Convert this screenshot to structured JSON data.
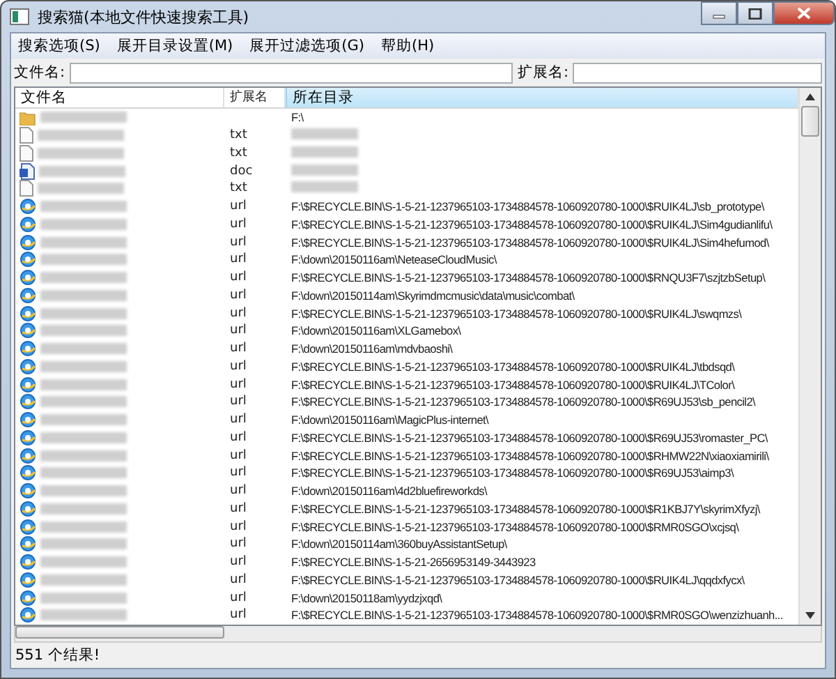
{
  "window": {
    "title": "搜索猫(本地文件快速搜索工具)"
  },
  "menu": [
    "搜索选项(S)",
    "展开目录设置(M)",
    "展开过滤选项(G)",
    "帮助(H)"
  ],
  "filters": [
    {
      "label": "文件名:"
    },
    {
      "label": "扩展名:"
    }
  ],
  "table": {
    "columns": [
      "文件名",
      "扩展名",
      "所在目录"
    ],
    "rows": [
      {
        "kind": "folder",
        "dir": "F:\\"
      },
      {
        "kind": "text",
        "ext": "txt"
      },
      {
        "kind": "text",
        "ext": "txt"
      },
      {
        "kind": "doc",
        "ext": "doc"
      },
      {
        "kind": "text",
        "ext": "txt"
      },
      {
        "kind": "web",
        "ext": "url",
        "dir": "F:\\$RECYCLE.BIN\\S-1-5-21-1237965103-1734884578-1060920780-1000\\$RUIK4LJ\\sb_prototype\\"
      },
      {
        "kind": "web",
        "ext": "url",
        "dir": "F:\\$RECYCLE.BIN\\S-1-5-21-1237965103-1734884578-1060920780-1000\\$RUIK4LJ\\Sim4gudianlifu\\"
      },
      {
        "kind": "web",
        "ext": "url",
        "dir": "F:\\$RECYCLE.BIN\\S-1-5-21-1237965103-1734884578-1060920780-1000\\$RUIK4LJ\\Sim4hefumod\\"
      },
      {
        "kind": "web",
        "ext": "url",
        "dir": "F:\\down\\20150116am\\NeteaseCloudMusic\\"
      },
      {
        "kind": "web",
        "ext": "url",
        "dir": "F:\\$RECYCLE.BIN\\S-1-5-21-1237965103-1734884578-1060920780-1000\\$RNQU3F7\\szjtzbSetup\\"
      },
      {
        "kind": "web",
        "ext": "url",
        "dir": "F:\\down\\20150114am\\Skyrimdmcmusic\\data\\music\\combat\\"
      },
      {
        "kind": "web",
        "ext": "url",
        "dir": "F:\\$RECYCLE.BIN\\S-1-5-21-1237965103-1734884578-1060920780-1000\\$RUIK4LJ\\swqmzs\\"
      },
      {
        "kind": "web",
        "ext": "url",
        "dir": "F:\\down\\20150116am\\XLGamebox\\"
      },
      {
        "kind": "web",
        "ext": "url",
        "dir": "F:\\down\\20150116am\\mdvbaoshi\\"
      },
      {
        "kind": "web",
        "ext": "url",
        "dir": "F:\\$RECYCLE.BIN\\S-1-5-21-1237965103-1734884578-1060920780-1000\\$RUIK4LJ\\tbdsqd\\"
      },
      {
        "kind": "web",
        "ext": "url",
        "dir": "F:\\$RECYCLE.BIN\\S-1-5-21-1237965103-1734884578-1060920780-1000\\$RUIK4LJ\\TColor\\"
      },
      {
        "kind": "web",
        "ext": "url",
        "dir": "F:\\$RECYCLE.BIN\\S-1-5-21-1237965103-1734884578-1060920780-1000\\$R69UJ53\\sb_pencil2\\"
      },
      {
        "kind": "web",
        "ext": "url",
        "dir": "F:\\down\\20150116am\\MagicPlus-internet\\"
      },
      {
        "kind": "web",
        "ext": "url",
        "dir": "F:\\$RECYCLE.BIN\\S-1-5-21-1237965103-1734884578-1060920780-1000\\$R69UJ53\\romaster_PC\\"
      },
      {
        "kind": "web",
        "ext": "url",
        "dir": "F:\\$RECYCLE.BIN\\S-1-5-21-1237965103-1734884578-1060920780-1000\\$RHMW22N\\xiaoxiamirili\\"
      },
      {
        "kind": "web",
        "ext": "url",
        "dir": "F:\\$RECYCLE.BIN\\S-1-5-21-1237965103-1734884578-1060920780-1000\\$R69UJ53\\aimp3\\"
      },
      {
        "kind": "web",
        "ext": "url",
        "dir": "F:\\down\\20150116am\\4d2bluefireworkds\\"
      },
      {
        "kind": "web",
        "ext": "url",
        "dir": "F:\\$RECYCLE.BIN\\S-1-5-21-1237965103-1734884578-1060920780-1000\\$R1KBJ7Y\\skyrimXfyzj\\"
      },
      {
        "kind": "web",
        "ext": "url",
        "dir": "F:\\$RECYCLE.BIN\\S-1-5-21-1237965103-1734884578-1060920780-1000\\$RMR0SGO\\xcjsq\\"
      },
      {
        "kind": "web",
        "ext": "url",
        "dir": "F:\\down\\20150114am\\360buyAssistantSetup\\"
      },
      {
        "kind": "web",
        "ext": "url",
        "dir": "F:\\$RECYCLE.BIN\\S-1-5-21-2656953149-3443923"
      },
      {
        "kind": "web",
        "ext": "url",
        "dir": "F:\\$RECYCLE.BIN\\S-1-5-21-1237965103-1734884578-1060920780-1000\\$RUIK4LJ\\qqdxfycx\\"
      },
      {
        "kind": "web",
        "ext": "url",
        "dir": "F:\\down\\20150118am\\yydzjxqd\\"
      },
      {
        "kind": "web",
        "ext": "url",
        "dir": "F:\\$RECYCLE.BIN\\S-1-5-21-1237965103-1734884578-1060920780-1000\\$RMR0SGO\\wenzizhuanh..."
      }
    ]
  },
  "status_bar": "551 个结果!"
}
